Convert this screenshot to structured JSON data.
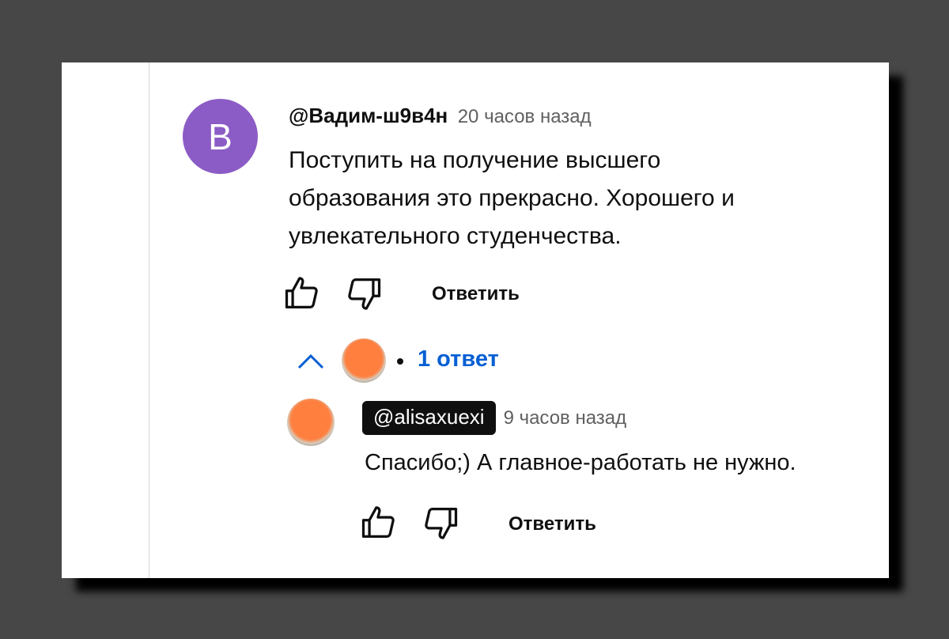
{
  "comment": {
    "avatar_letter": "B",
    "author": "@Вадим-ш9в4н",
    "time": "20 часов назад",
    "text_lines": [
      "Поступить на получение высшего",
      "образования это прекрасно. Хорошего и",
      "увлекательного студенчества."
    ],
    "reply_label": "Ответить",
    "like_icon": "thumbs-up-icon",
    "dislike_icon": "thumbs-down-icon"
  },
  "replies_toggle": {
    "icon": "chevron-up-icon",
    "label": "1 ответ"
  },
  "reply": {
    "author": "@alisaxuexi",
    "time": "9 часов назад",
    "text": "Спасибо;) А главное-работать не нужно.",
    "reply_label": "Ответить"
  },
  "colors": {
    "background": "#474747",
    "card": "#ffffff",
    "avatar_purple": "#8b5cc5",
    "avatar_orange": "#ff7f3f",
    "link_blue": "#065fd4",
    "meta_gray": "#606060"
  }
}
